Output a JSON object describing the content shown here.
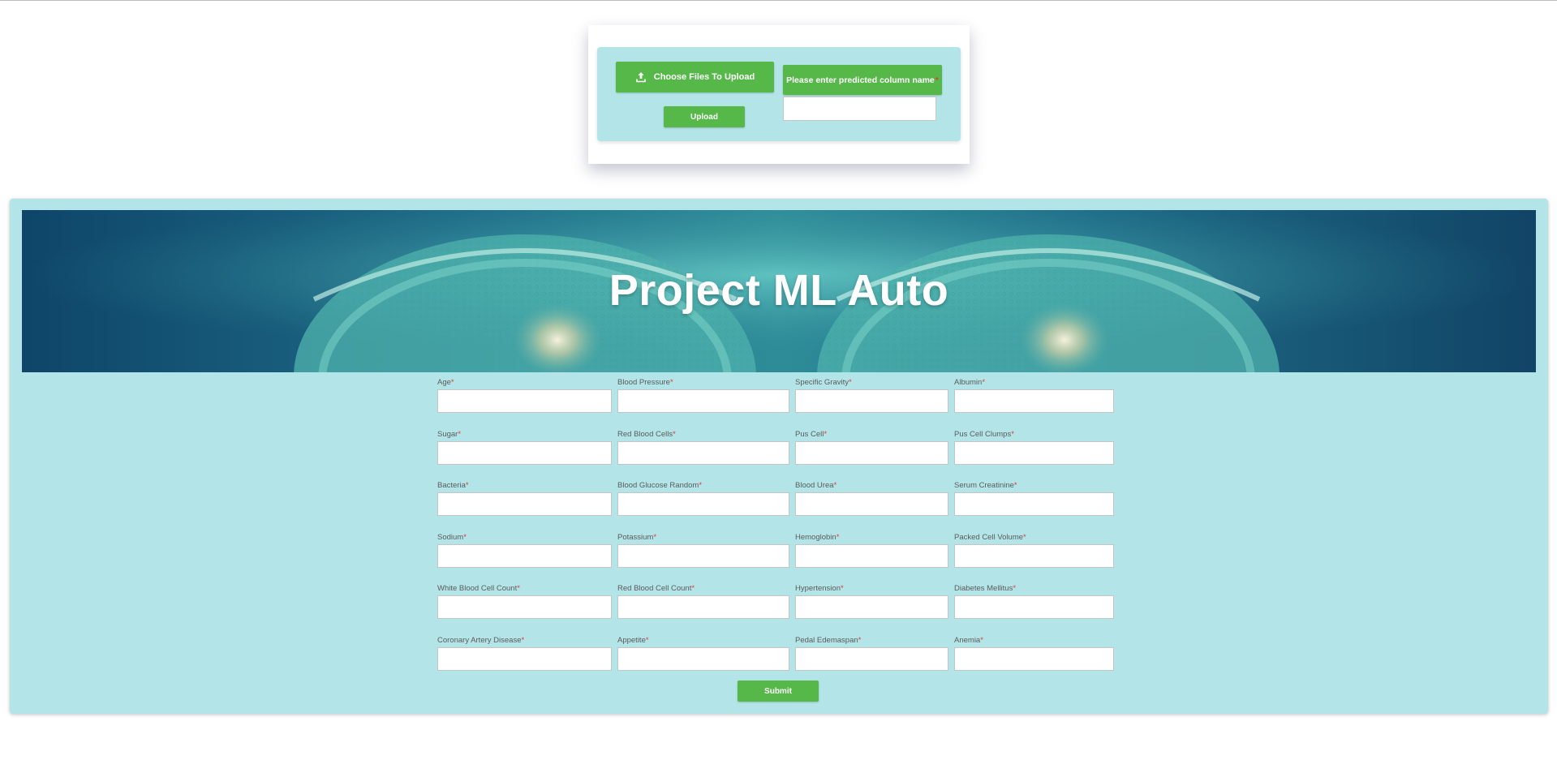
{
  "upload": {
    "choose_label": "Choose Files To Upload",
    "upload_label": "Upload",
    "column_label": "Please enter predicted column name",
    "column_value": "",
    "required_mark": "*"
  },
  "header": {
    "title": "Project ML Auto"
  },
  "form": {
    "required_mark": "*",
    "fields": [
      {
        "label": "Age",
        "value": ""
      },
      {
        "label": "Blood Pressure",
        "value": ""
      },
      {
        "label": "Specific Gravity",
        "value": ""
      },
      {
        "label": "Albumin",
        "value": ""
      },
      {
        "label": "Sugar",
        "value": ""
      },
      {
        "label": "Red Blood Cells",
        "value": ""
      },
      {
        "label": "Pus Cell",
        "value": ""
      },
      {
        "label": "Pus Cell Clumps",
        "value": ""
      },
      {
        "label": "Bacteria",
        "value": ""
      },
      {
        "label": "Blood Glucose Random",
        "value": ""
      },
      {
        "label": "Blood Urea",
        "value": ""
      },
      {
        "label": "Serum Creatinine",
        "value": ""
      },
      {
        "label": "Sodium",
        "value": ""
      },
      {
        "label": "Potassium",
        "value": ""
      },
      {
        "label": "Hemoglobin",
        "value": ""
      },
      {
        "label": "Packed Cell Volume",
        "value": ""
      },
      {
        "label": "White Blood Cell Count",
        "value": ""
      },
      {
        "label": "Red Blood Cell Count",
        "value": ""
      },
      {
        "label": "Hypertension",
        "value": ""
      },
      {
        "label": "Diabetes Mellitus",
        "value": ""
      },
      {
        "label": "Coronary Artery Disease",
        "value": ""
      },
      {
        "label": "Appetite",
        "value": ""
      },
      {
        "label": "Pedal Edemaspan",
        "value": ""
      },
      {
        "label": "Anemia",
        "value": ""
      }
    ],
    "submit_label": "Submit"
  },
  "colors": {
    "accent_green": "#56b848",
    "panel_teal": "#b3e5e8",
    "required_red": "#e53935"
  }
}
